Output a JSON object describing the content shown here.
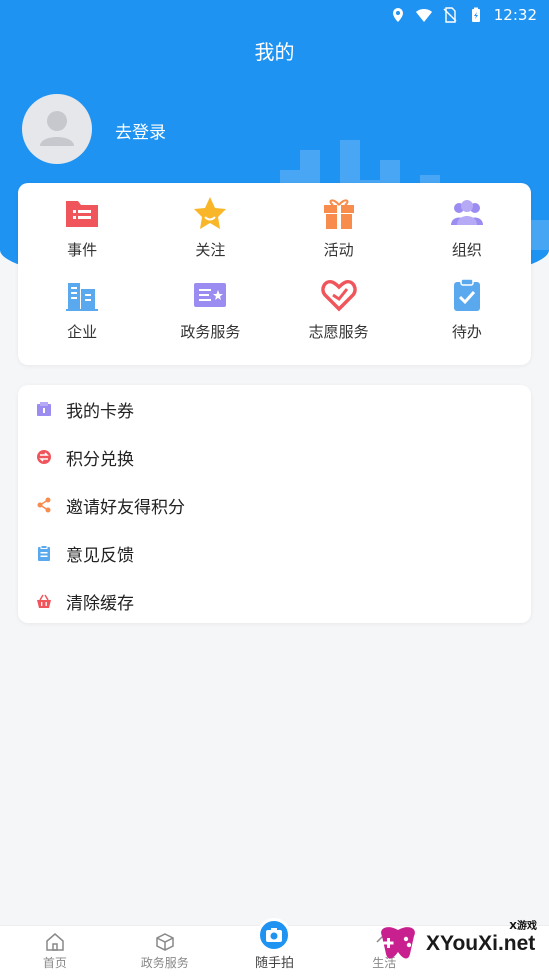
{
  "status_bar": {
    "time": "12:32"
  },
  "header": {
    "title": "我的"
  },
  "profile": {
    "login_text": "去登录"
  },
  "grid": [
    {
      "label": "事件",
      "icon": "folder-list-icon",
      "color": "#f0555b"
    },
    {
      "label": "关注",
      "icon": "star-icon",
      "color": "#f8b628"
    },
    {
      "label": "活动",
      "icon": "gift-icon",
      "color": "#f78c4c"
    },
    {
      "label": "组织",
      "icon": "group-icon",
      "color": "#9b8cf2"
    },
    {
      "label": "企业",
      "icon": "building-icon",
      "color": "#5aa8ee"
    },
    {
      "label": "政务服务",
      "icon": "id-card-icon",
      "color": "#9b8cf2"
    },
    {
      "label": "志愿服务",
      "icon": "heart-hand-icon",
      "color": "#f0555b"
    },
    {
      "label": "待办",
      "icon": "clipboard-check-icon",
      "color": "#5aa8ee"
    }
  ],
  "menu": [
    {
      "label": "我的卡券",
      "icon": "coupon-icon",
      "color": "#9b8cf2"
    },
    {
      "label": "积分兑换",
      "icon": "exchange-icon",
      "color": "#f0555b"
    },
    {
      "label": "邀请好友得积分",
      "icon": "share-icon",
      "color": "#f78c4c"
    },
    {
      "label": "意见反馈",
      "icon": "feedback-icon",
      "color": "#5aa8ee"
    },
    {
      "label": "清除缓存",
      "icon": "basket-icon",
      "color": "#f0555b"
    }
  ],
  "tabbar": [
    {
      "label": "首页",
      "icon": "home-icon"
    },
    {
      "label": "政务服务",
      "icon": "cube-icon"
    },
    {
      "label": "随手拍",
      "icon": "camera-icon"
    },
    {
      "label": "生活",
      "icon": "life-icon"
    },
    {
      "label": "",
      "icon": "profile-icon"
    }
  ],
  "watermark": {
    "text": "XYouXi.net",
    "small": "X游戏"
  }
}
